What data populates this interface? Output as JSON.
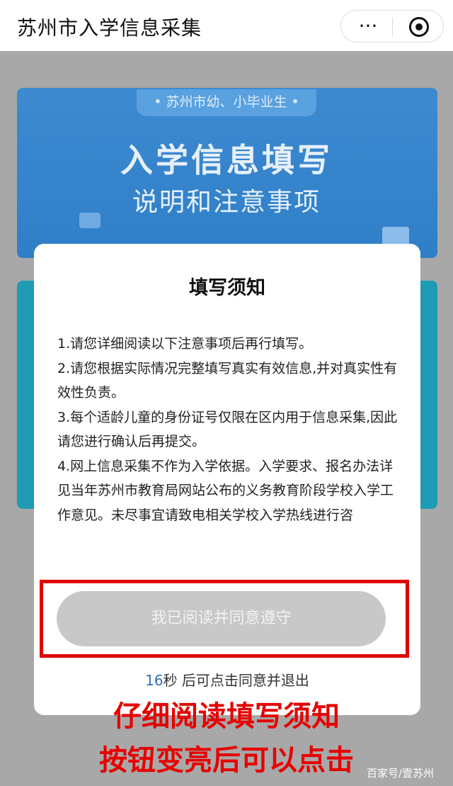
{
  "header": {
    "title": "苏州市入学信息采集",
    "more_icon": "···"
  },
  "banner": {
    "tag": "•  苏州市幼、小毕业生  •",
    "title": "入学信息填写",
    "subtitle": "说明和注意事项"
  },
  "modal": {
    "title": "填写须知",
    "notice_items": [
      "1.请您详细阅读以下注意事项后再行填写。",
      "2.请您根据实际情况完整填写真实有效信息,并对真实性有效性负责。",
      "3.每个适龄儿童的身份证号仅限在区内用于信息采集,因此请您进行确认后再提交。",
      "4.网上信息采集不作为入学依据。入学要求、报名办法详见当年苏州市教育局网站公布的义务教育阶段学校入学工作意见。未尽事宜请致电相关学校入学热线进行咨"
    ],
    "agree_button": "我已阅读并同意遵守",
    "countdown_seconds": "16",
    "countdown_text": "秒 后可点击同意并退出"
  },
  "annotation": {
    "line1": "仔细阅读填写须知",
    "line2": "按钮变亮后可以点击"
  },
  "watermark": "百家号/壹苏州",
  "colors": {
    "highlight": "#e00000",
    "caption": "#e60000",
    "banner_blue": "#3d8ad0",
    "card_teal": "#1f9bb6",
    "button_disabled": "#c8c8c8",
    "countdown_number": "#2f6fb6"
  }
}
